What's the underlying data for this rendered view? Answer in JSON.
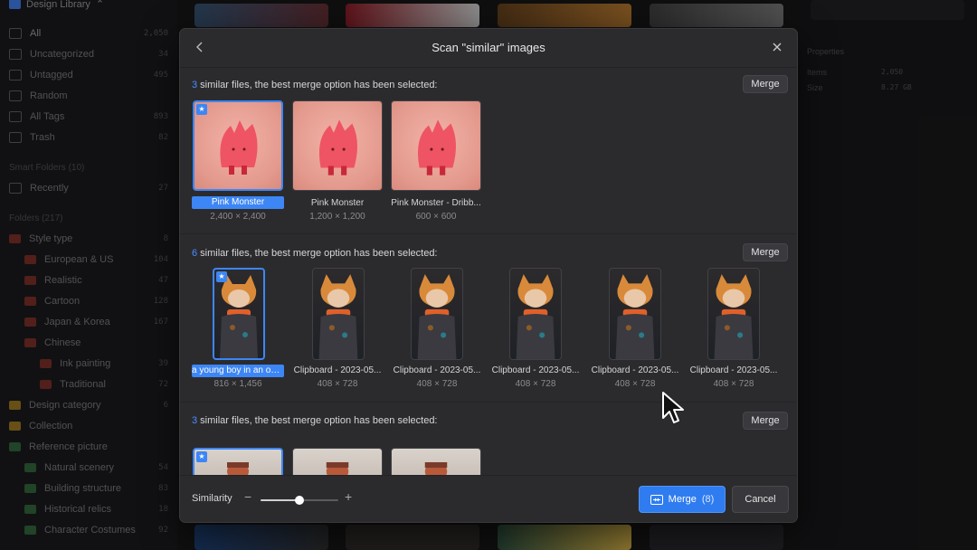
{
  "app": {
    "library_title": "Design Library",
    "sidebar": {
      "items": [
        {
          "label": "All",
          "count": "2,050"
        },
        {
          "label": "Uncategorized",
          "count": "34"
        },
        {
          "label": "Untagged",
          "count": "495"
        },
        {
          "label": "Random",
          "count": ""
        },
        {
          "label": "All Tags",
          "count": "893"
        },
        {
          "label": "Trash",
          "count": "82"
        }
      ],
      "smart_folders_header": "Smart Folders (10)",
      "smart_folders": [
        {
          "label": "Recently",
          "count": "27"
        }
      ],
      "folders_header": "Folders (217)",
      "folders": [
        {
          "label": "Style type",
          "count": "8"
        },
        {
          "label": "European & US",
          "count": "104"
        },
        {
          "label": "Realistic",
          "count": "47"
        },
        {
          "label": "Cartoon",
          "count": "128"
        },
        {
          "label": "Japan & Korea",
          "count": "167"
        },
        {
          "label": "Chinese",
          "count": ""
        },
        {
          "label": "Ink painting",
          "count": "39"
        },
        {
          "label": "Traditional",
          "count": "72"
        },
        {
          "label": "Design category",
          "count": "6"
        },
        {
          "label": "Collection",
          "count": ""
        },
        {
          "label": "Reference picture",
          "count": ""
        },
        {
          "label": "Natural scenery",
          "count": "54"
        },
        {
          "label": "Building structure",
          "count": "83"
        },
        {
          "label": "Historical relics",
          "count": "18"
        },
        {
          "label": "Character Costumes",
          "count": "92"
        }
      ]
    },
    "right_panel": {
      "title": "Properties",
      "items_label": "Items",
      "items_value": "2,050",
      "size_label": "Size",
      "size_value": "8.27 GB"
    }
  },
  "dialog": {
    "title": "Scan \"similar\" images",
    "group_suffix": " similar files, the best merge option has been selected:",
    "merge_label": "Merge",
    "groups": [
      {
        "count": "3",
        "items": [
          {
            "caption": "Pink Monster",
            "size": "2,400 × 2,400"
          },
          {
            "caption": "Pink Monster",
            "size": "1,200 × 1,200"
          },
          {
            "caption": "Pink Monster - Dribb...",
            "size": "600 × 600"
          }
        ]
      },
      {
        "count": "6",
        "items": [
          {
            "caption": "a young boy in an out...",
            "size": "816 × 1,456"
          },
          {
            "caption": "Clipboard - 2023-05...",
            "size": "408 × 728"
          },
          {
            "caption": "Clipboard - 2023-05...",
            "size": "408 × 728"
          },
          {
            "caption": "Clipboard - 2023-05...",
            "size": "408 × 728"
          },
          {
            "caption": "Clipboard - 2023-05...",
            "size": "408 × 728"
          },
          {
            "caption": "Clipboard - 2023-05...",
            "size": "408 × 728"
          }
        ]
      },
      {
        "count": "3",
        "items": [
          {},
          {},
          {}
        ]
      }
    ],
    "footer": {
      "similarity_label": "Similarity",
      "minus": "−",
      "plus": "+",
      "similarity_value": 0.5,
      "merge_button_label": "Merge",
      "merge_button_count": "(8)",
      "cancel_label": "Cancel"
    }
  },
  "colors": {
    "accent": "#3d86f5",
    "dialog_bg": "#2b2b2e"
  }
}
